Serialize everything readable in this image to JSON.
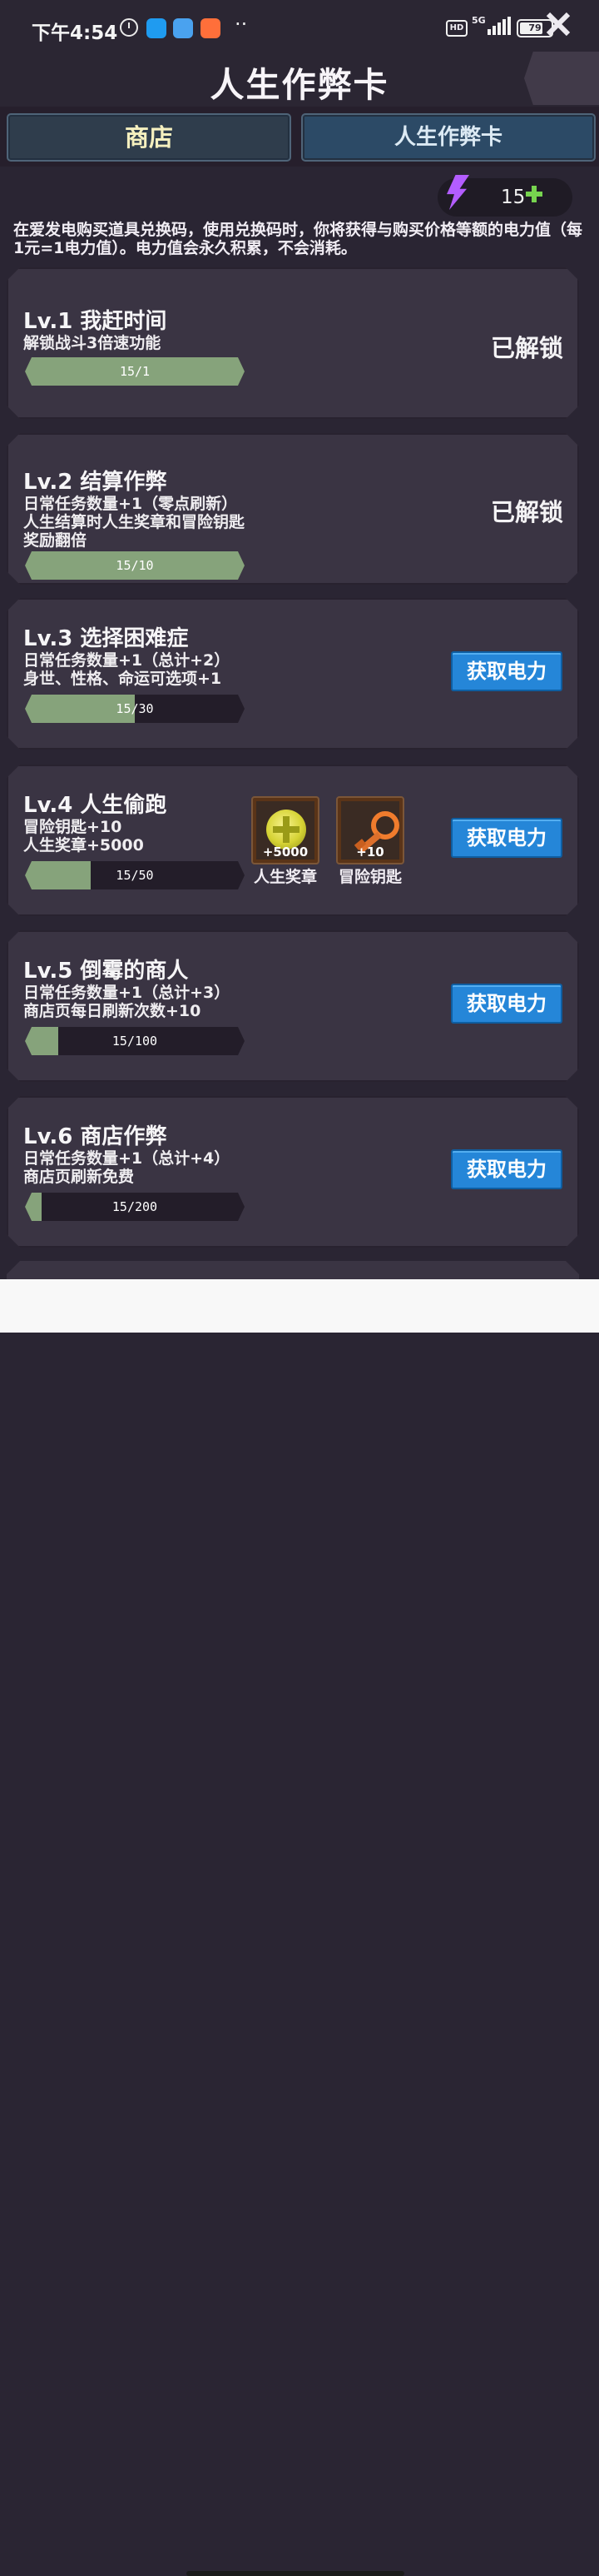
{
  "status_bar": {
    "time": "下午4:54",
    "hd": "HD",
    "network": "5G",
    "battery": "79",
    "more": "··"
  },
  "header": {
    "title": "人生作弊卡"
  },
  "tabs": [
    {
      "label": "商店"
    },
    {
      "label": "人生作弊卡"
    }
  ],
  "energy": {
    "value": "15"
  },
  "intro": {
    "text": "在爱发电购买道具兑换码，使用兑换码时，你将获得与购买价格等额的电力值（每1元=1电力值）。电力值会永久积累，不会消耗。"
  },
  "cards": [
    {
      "title": "Lv.1 我赶时间",
      "desc": "解锁战斗3倍速功能",
      "progress_text": "15/1",
      "progress_fraction": 1.0,
      "status": "已解锁"
    },
    {
      "title": "Lv.2 结算作弊",
      "desc": "日常任务数量+1（零点刷新）\n人生结算时人生奖章和冒险钥匙奖励翻倍",
      "progress_text": "15/10",
      "progress_fraction": 1.0,
      "status": "已解锁"
    },
    {
      "title": "Lv.3 选择困难症",
      "desc": "日常任务数量+1（总计+2）\n身世、性格、命运可选项+1",
      "progress_text": "15/30",
      "progress_fraction": 0.5,
      "button": "获取电力"
    },
    {
      "title": "Lv.4 人生偷跑",
      "desc": "冒险钥匙+10\n人生奖章+5000",
      "progress_text": "15/50",
      "progress_fraction": 0.3,
      "button": "获取电力",
      "rewards": [
        {
          "icon": "medal-icon",
          "count": "+5000",
          "label": "人生奖章"
        },
        {
          "icon": "key-icon",
          "count": "+10",
          "label": "冒险钥匙"
        }
      ]
    },
    {
      "title": "Lv.5 倒霉的商人",
      "desc": "日常任务数量+1（总计+3）\n商店页每日刷新次数+10",
      "progress_text": "15/100",
      "progress_fraction": 0.15,
      "button": "获取电力"
    },
    {
      "title": "Lv.6 商店作弊",
      "desc": "日常任务数量+1（总计+4）\n商店页刷新免费",
      "progress_text": "15/200",
      "progress_fraction": 0.075,
      "button": "获取电力"
    }
  ],
  "colors": {
    "background": "#2a2533",
    "card": "#3a3443",
    "progress_fill": "#86a37b",
    "button": "#2586d8",
    "lightning": "#b35dff",
    "plus": "#77d44f"
  }
}
